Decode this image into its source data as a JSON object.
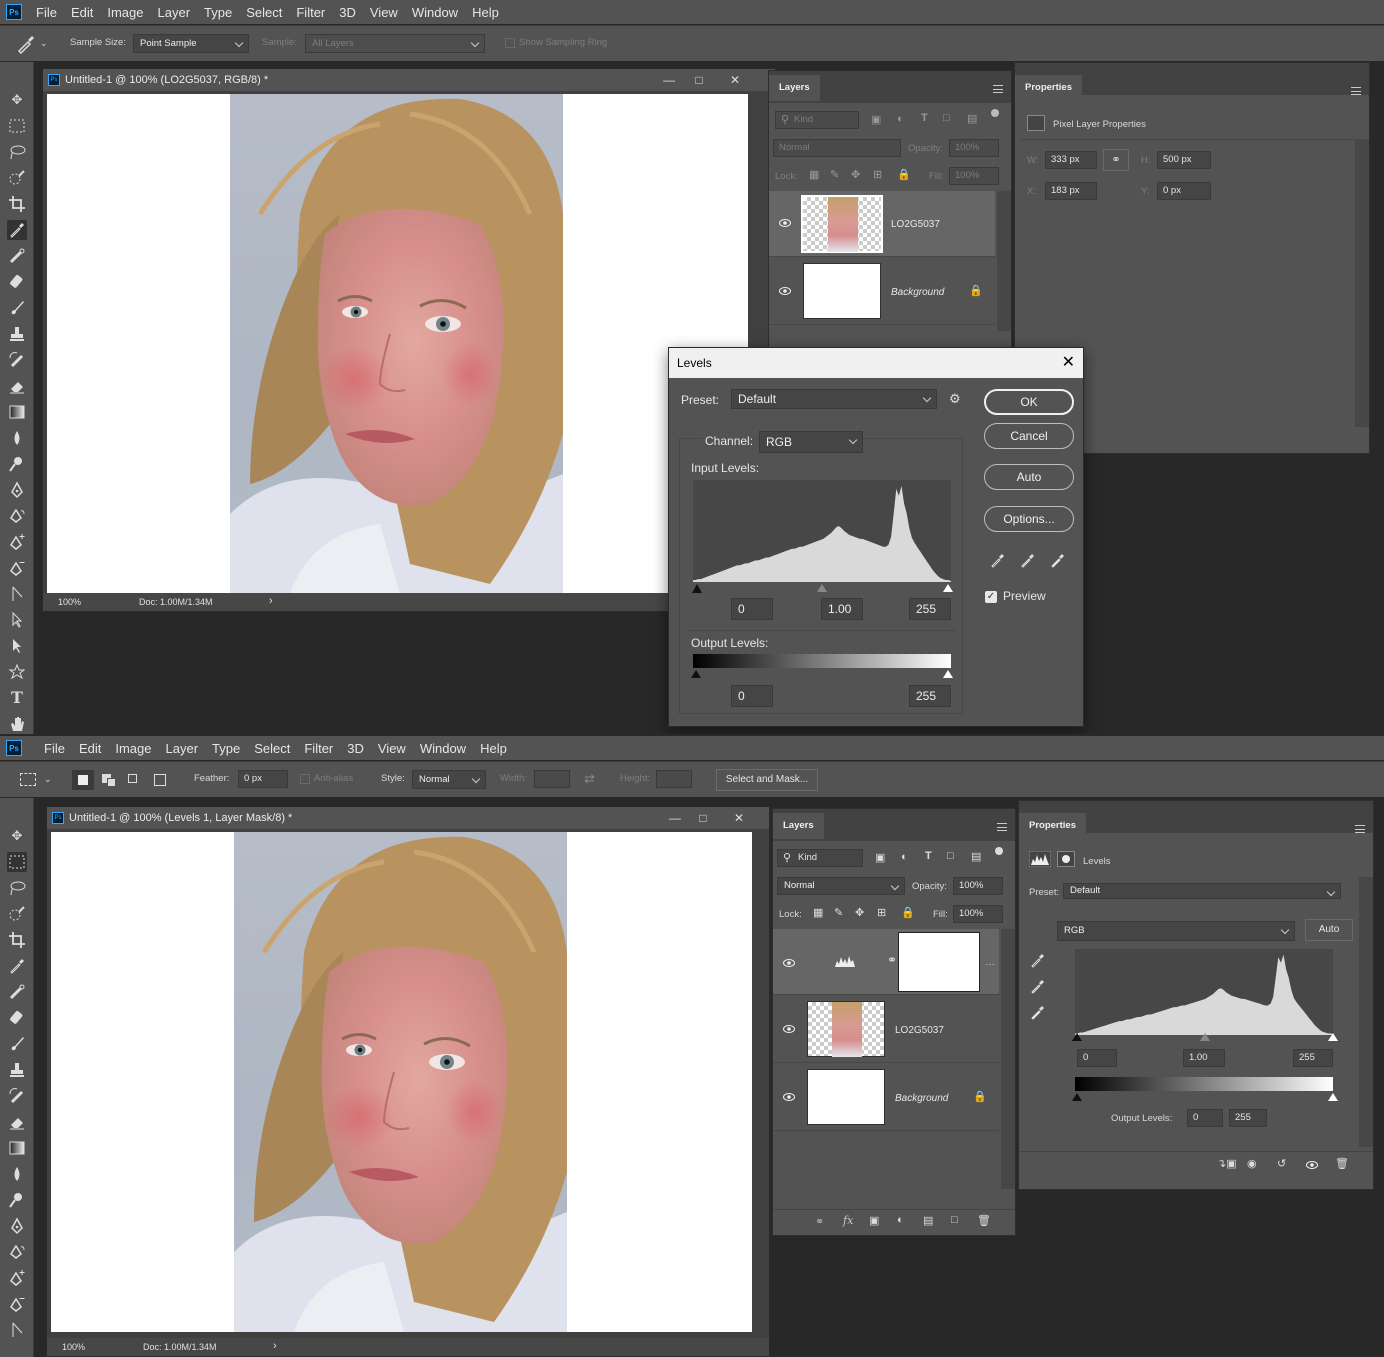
{
  "menu": [
    "File",
    "Edit",
    "Image",
    "Layer",
    "Type",
    "Select",
    "Filter",
    "3D",
    "View",
    "Window",
    "Help"
  ],
  "app_logo": "Ps",
  "top": {
    "options": {
      "sample_size_label": "Sample Size:",
      "sample_size_value": "Point Sample",
      "sample_label": "Sample:",
      "sample_value": "All Layers",
      "show_ring": "Show Sampling Ring"
    },
    "doc": {
      "title": "Untitled-1 @ 100% (LO2G5037, RGB/8) *",
      "zoom": "100%",
      "doc_size": "Doc: 1.00M/1.34M"
    },
    "layers": {
      "tab": "Layers",
      "kind": "Kind",
      "blend": "Normal",
      "opacity_label": "Opacity:",
      "opacity": "100%",
      "lock_label": "Lock:",
      "fill_label": "Fill:",
      "fill": "100%",
      "items": [
        {
          "name": "LO2G5037"
        },
        {
          "name": "Background"
        }
      ]
    },
    "properties": {
      "tab": "Properties",
      "kind": "Pixel Layer Properties",
      "w_label": "W:",
      "w": "333 px",
      "h_label": "H:",
      "h": "500 px",
      "x_label": "X:",
      "x": "183 px",
      "y_label": "Y:",
      "y": "0 px"
    },
    "levels_dialog": {
      "title": "Levels",
      "preset_label": "Preset:",
      "preset": "Default",
      "channel_label": "Channel:",
      "channel": "RGB",
      "input_label": "Input Levels:",
      "in_black": "0",
      "in_gamma": "1.00",
      "in_white": "255",
      "output_label": "Output Levels:",
      "out_black": "0",
      "out_white": "255",
      "ok": "OK",
      "cancel": "Cancel",
      "auto": "Auto",
      "options": "Options...",
      "preview": "Preview",
      "preview_checked": true
    }
  },
  "bottom": {
    "options": {
      "feather_label": "Feather:",
      "feather": "0 px",
      "antialias": "Anti-alias",
      "style_label": "Style:",
      "style": "Normal",
      "width_label": "Width:",
      "height_label": "Height:",
      "select_mask": "Select and Mask..."
    },
    "doc": {
      "title": "Untitled-1 @ 100% (Levels 1, Layer Mask/8) *",
      "zoom": "100%",
      "doc_size": "Doc: 1.00M/1.34M"
    },
    "layers": {
      "tab": "Layers",
      "kind": "Kind",
      "blend": "Normal",
      "opacity_label": "Opacity:",
      "opacity": "100%",
      "lock_label": "Lock:",
      "fill_label": "Fill:",
      "fill": "100%",
      "items": [
        {
          "name": ""
        },
        {
          "name": "LO2G5037"
        },
        {
          "name": "Background"
        }
      ]
    },
    "properties": {
      "tab": "Properties",
      "kind": "Levels",
      "preset_label": "Preset:",
      "preset": "Default",
      "channel": "RGB",
      "auto": "Auto",
      "in_black": "0",
      "in_gamma": "1.00",
      "in_white": "255",
      "output_label": "Output Levels:",
      "out_black": "0",
      "out_white": "255"
    }
  },
  "histogram": [
    2,
    2,
    3,
    3,
    4,
    5,
    6,
    7,
    8,
    9,
    10,
    11,
    12,
    13,
    14,
    15,
    16,
    17,
    17,
    18,
    19,
    19,
    20,
    21,
    22,
    22,
    23,
    24,
    25,
    25,
    26,
    27,
    28,
    29,
    30,
    31,
    32,
    33,
    34,
    34,
    35,
    36,
    36,
    37,
    38,
    39,
    40,
    41,
    42,
    43,
    44,
    46,
    48,
    50,
    53,
    56,
    57,
    55,
    52,
    50,
    48,
    47,
    46,
    45,
    44,
    44,
    43,
    42,
    41,
    40,
    39,
    38,
    37,
    36,
    36,
    38,
    46,
    70,
    95,
    88,
    98,
    80,
    70,
    55,
    45,
    40,
    36,
    32,
    28,
    24,
    20,
    16,
    12,
    9,
    6,
    4,
    3,
    2,
    2,
    1
  ]
}
